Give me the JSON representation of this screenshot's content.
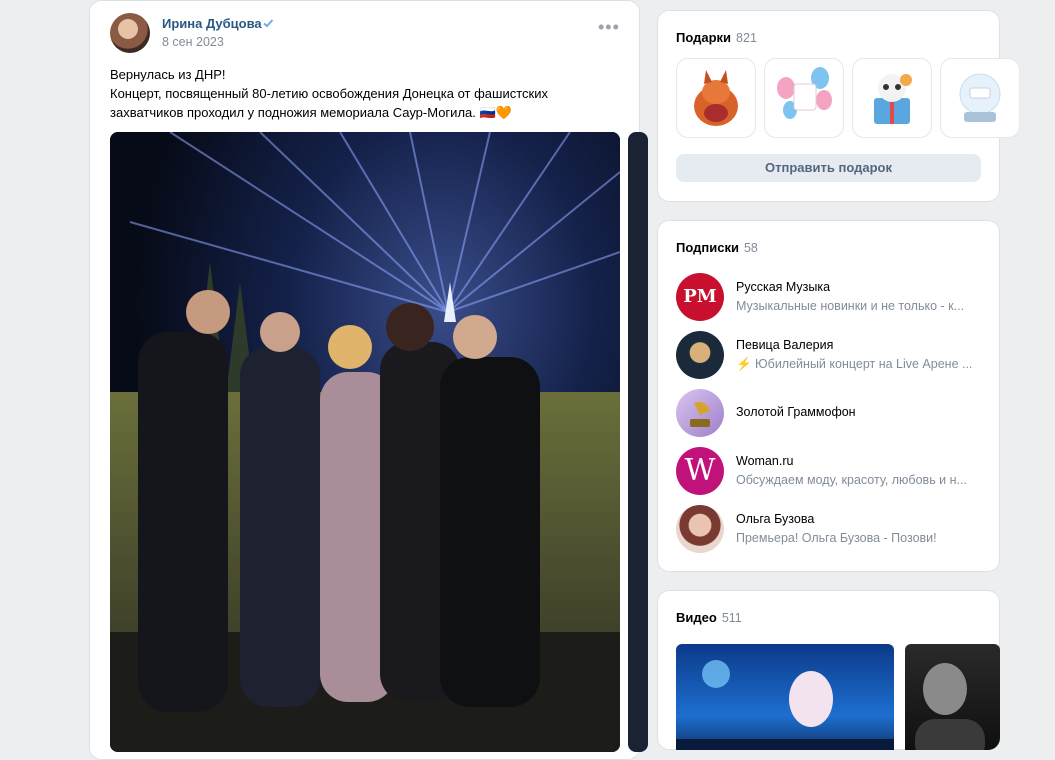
{
  "post": {
    "author": "Ирина Дубцова",
    "date": "8 сен 2023",
    "text_lines": [
      "Вернулась из ДНР!",
      "Концерт, посвященный 80-летию освобождения Донецка от фашистских",
      "захватчиков проходил у подножия мемориала Саур-Могила. 🇷🇺🧡"
    ]
  },
  "gifts": {
    "title": "Подарки",
    "count": "821",
    "send_label": "Отправить подарок",
    "items": [
      "fox-gift",
      "balloons-gift",
      "cat-in-box-gift",
      "snow-globe-gift"
    ]
  },
  "subscriptions": {
    "title": "Подписки",
    "count": "58",
    "items": [
      {
        "name": "Русская Музыка",
        "desc": "Музыкальные новинки и не только - к...",
        "color": "#c8102e"
      },
      {
        "name": "Певица Валерия",
        "desc": "⚡ Юбилейный концерт на Live Арене ...",
        "color": "#1b2a3a"
      },
      {
        "name": "Золотой Граммофон",
        "desc": "",
        "color": "#b69ad6"
      },
      {
        "name": "Woman.ru",
        "desc": "Обсуждаем моду, красоту, любовь и н...",
        "color": "#c0127a"
      },
      {
        "name": "Ольга Бузова",
        "desc": "Премьера! Ольга Бузова - Позови!",
        "color": "#d9b8a6"
      }
    ]
  },
  "video": {
    "title": "Видео",
    "count": "511"
  }
}
